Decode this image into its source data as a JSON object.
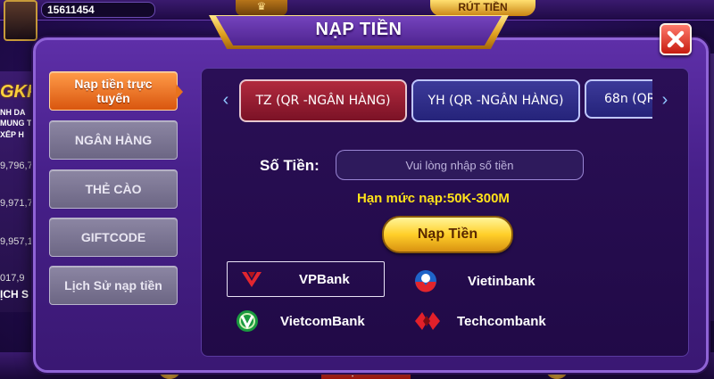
{
  "background": {
    "balance": "15611454",
    "top_button": "RÚT TIỀN",
    "bottom_button": "NẠP TIỀN",
    "left_brand": "GKP",
    "left_lines": [
      "NH DA",
      "MUNG T",
      "XẾP H"
    ],
    "left_numbers": [
      "9,796,7",
      "9,971,7",
      "9,957,1",
      "017,9"
    ],
    "left_bottom": "ỊCH S"
  },
  "modal": {
    "title": "NẠP TIỀN",
    "close_icon": "close-x-icon"
  },
  "nav": {
    "items": [
      {
        "label": "Nạp tiền trực tuyến",
        "active": true
      },
      {
        "label": "NGÂN HÀNG",
        "active": false
      },
      {
        "label": "THẺ CÀO",
        "active": false
      },
      {
        "label": "GIFTCODE",
        "active": false
      },
      {
        "label": "Lịch Sử nạp tiền",
        "active": false
      }
    ]
  },
  "channels": {
    "prev_icon": "chevron-left-icon",
    "next_icon": "chevron-right-icon",
    "tabs": [
      {
        "label": "TZ (QR -NGÂN HÀNG)",
        "selected": true
      },
      {
        "label": "YH (QR -NGÂN HÀNG)",
        "selected": false
      },
      {
        "label": "68n (QR",
        "selected": false
      }
    ]
  },
  "form": {
    "amount_label": "Số Tiền:",
    "amount_placeholder": "Vui lòng nhập số tiền",
    "amount_value": "",
    "limit_text": "Hạn mức nạp:50K-300M",
    "submit_label": "Nạp Tiền"
  },
  "banks": [
    {
      "name": "VPBank",
      "icon": "vpbank-logo-icon",
      "selected": true
    },
    {
      "name": "Vietinbank",
      "icon": "vietinbank-logo-icon",
      "selected": false
    },
    {
      "name": "VietcomBank",
      "icon": "vietcombank-logo-icon",
      "selected": false
    },
    {
      "name": "Techcombank",
      "icon": "techcombank-logo-icon",
      "selected": false
    }
  ],
  "colors": {
    "active_nav": "#e8721d",
    "selected_channel": "#9b1f33",
    "unselected_channel": "#2f2d8a",
    "limit_text": "#ffe21a",
    "submit_button": "#ffcf29"
  }
}
